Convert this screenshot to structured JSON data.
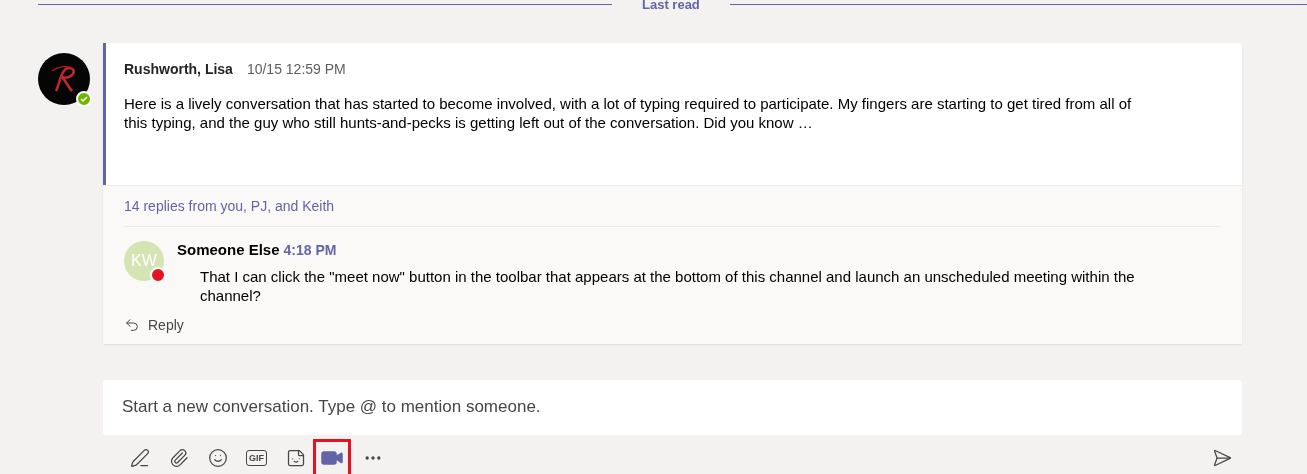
{
  "divider": {
    "label": "Last read"
  },
  "thread": {
    "author": "Rushworth, Lisa",
    "time": "10/15 12:59 PM",
    "presence": {
      "kind": "available",
      "color": "#6bb700"
    },
    "body": "Here is a lively conversation that has started to become involved, with a lot of typing required to participate. My fingers are starting to get tired from all of this typing, and the guy who still hunts-and-pecks is getting left out of the conversation. Did you know …",
    "replies_summary": "14 replies from you, PJ, and Keith",
    "replies": [
      {
        "author": "Someone Else",
        "time": "4:18 PM",
        "initials": "KW",
        "presence": {
          "kind": "busy",
          "color": "#e81123"
        },
        "body": "That I can click the \"meet now\" button in the toolbar that appears at the bottom of this channel and launch an unscheduled meeting within the channel?"
      }
    ],
    "reply_button": "Reply"
  },
  "compose": {
    "placeholder": "Start a new conversation. Type @ to mention someone."
  },
  "toolbar": [
    {
      "kind": "format",
      "highlighted": false
    },
    {
      "kind": "attach",
      "highlighted": false
    },
    {
      "kind": "emoji",
      "highlighted": false
    },
    {
      "kind": "gif",
      "label": "GIF",
      "highlighted": false
    },
    {
      "kind": "sticker",
      "highlighted": false
    },
    {
      "kind": "meet",
      "highlighted": true
    },
    {
      "kind": "more",
      "highlighted": false
    }
  ]
}
